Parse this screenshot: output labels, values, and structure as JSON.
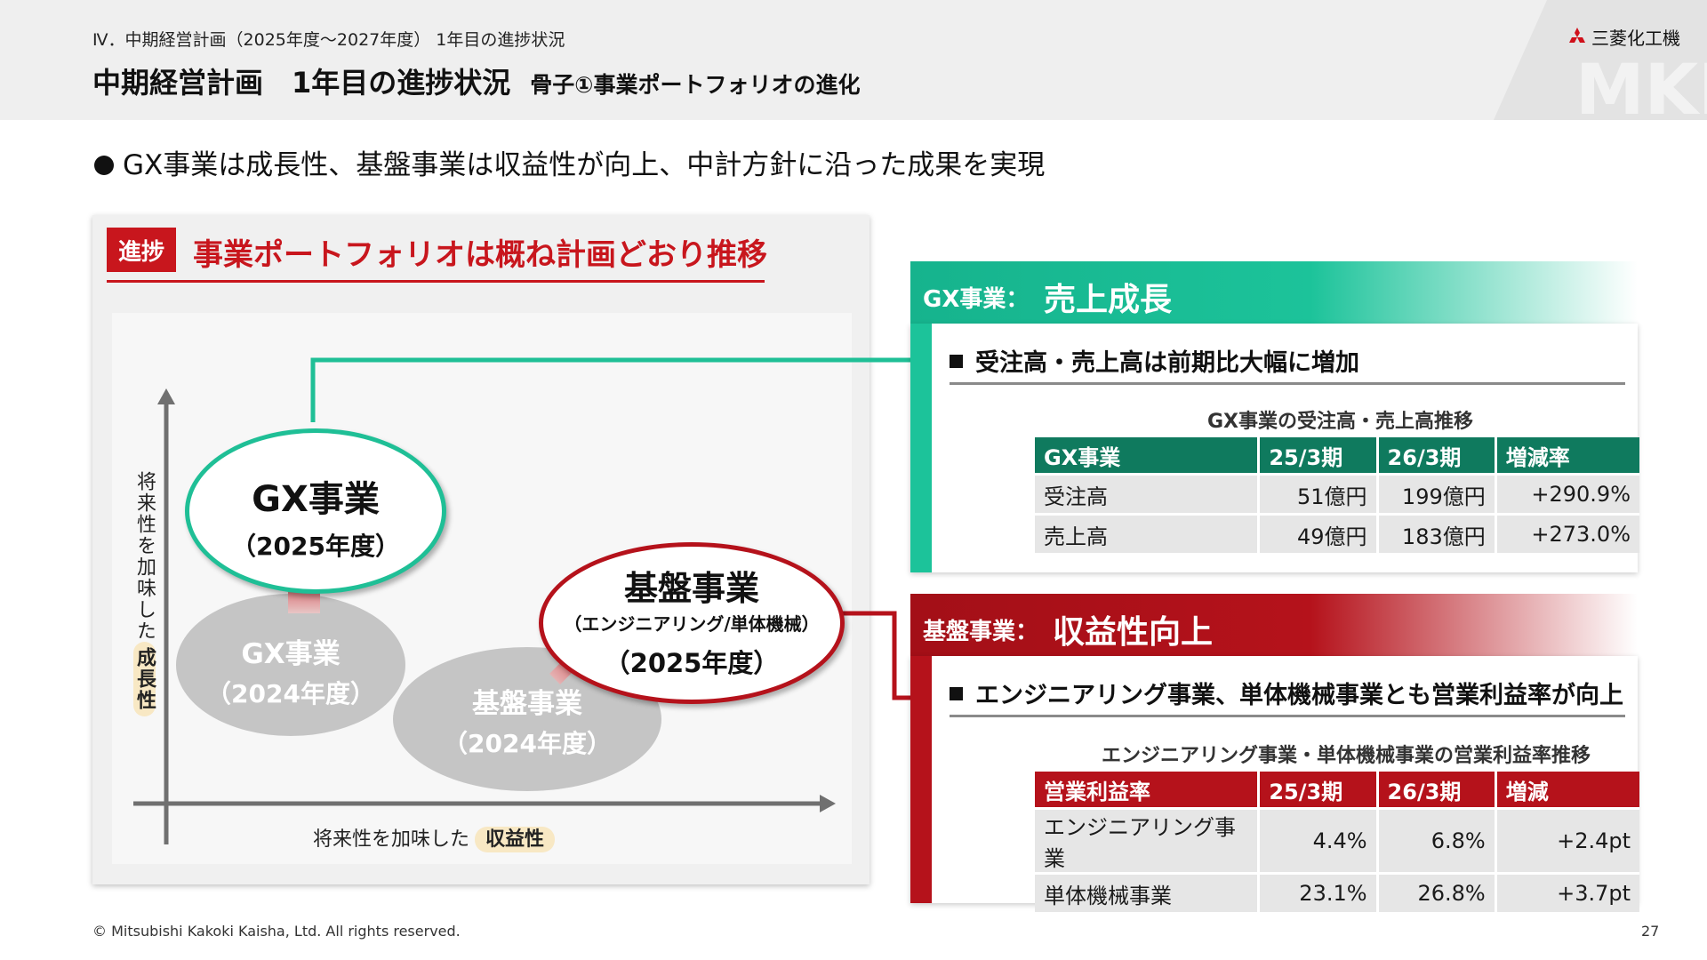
{
  "header": {
    "breadcrumb": "Ⅳ．中期経営計画（2025年度～2027年度） 1年目の進捗状況",
    "title": "中期経営計画　1年目の進捗状況",
    "subtitle": "骨子①事業ポートフォリオの進化",
    "brand": "三菱化工機",
    "watermark": "MKK"
  },
  "lead": "GX事業は成長性、基盤事業は収益性が向上、中計方針に沿った成果を実現",
  "left_panel": {
    "tag": "進捗",
    "title": "事業ポートフォリオは概ね計画どおり推移",
    "y_axis": {
      "text": "将来性を加味した",
      "highlight": "成長性"
    },
    "x_axis": {
      "text": "将来性を加味した",
      "highlight": "収益性"
    },
    "gx_2025": {
      "name": "GX事業",
      "year": "（2025年度）"
    },
    "gx_2024": {
      "name": "GX事業",
      "year": "（2024年度）"
    },
    "base_2025": {
      "name": "基盤事業",
      "detail": "（エンジニアリング/単体機械）",
      "year": "（2025年度）"
    },
    "base_2024": {
      "name": "基盤事業",
      "year": "（2024年度）"
    }
  },
  "gx_section": {
    "label": "GX事業：",
    "headline": "売上成長",
    "bullet": "受注高・売上高は前期比大幅に増加",
    "table_title": "GX事業の受注高・売上高推移",
    "columns": [
      "GX事業",
      "25/3期",
      "26/3期",
      "増減率"
    ],
    "rows": [
      [
        "受注高",
        "51億円",
        "199億円",
        "+290.9%"
      ],
      [
        "売上高",
        "49億円",
        "183億円",
        "+273.0%"
      ]
    ],
    "color": "#0f7a5e",
    "accent": "#1fbf96"
  },
  "base_section": {
    "label": "基盤事業：",
    "headline": "収益性向上",
    "bullet": "エンジニアリング事業、単体機械事業とも営業利益率が向上",
    "table_title": "エンジニアリング事業・単体機械事業の営業利益率推移",
    "columns": [
      "営業利益率",
      "25/3期",
      "26/3期",
      "増減"
    ],
    "rows": [
      [
        "エンジニアリング事業",
        "4.4%",
        "6.8%",
        "+2.4pt"
      ],
      [
        "単体機械事業",
        "23.1%",
        "26.8%",
        "+3.7pt"
      ]
    ],
    "color": "#b5121b"
  },
  "footer": {
    "copyright": "© Mitsubishi Kakoki Kaisha, Ltd. All rights reserved.",
    "page": "27"
  }
}
